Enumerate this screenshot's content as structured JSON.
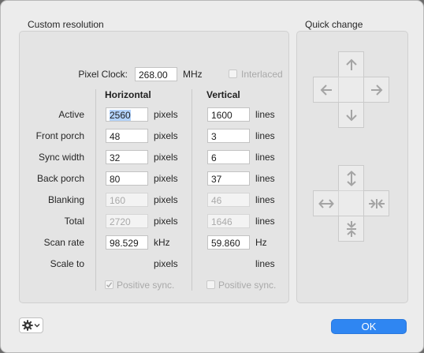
{
  "custom_resolution": {
    "title": "Custom resolution",
    "pixel_clock": {
      "label": "Pixel Clock:",
      "value": "268.00",
      "unit": "MHz"
    },
    "interlaced": {
      "label": "Interlaced",
      "checked": false
    },
    "horizontal_header": "Horizontal",
    "vertical_header": "Vertical",
    "rows": [
      {
        "label": "Active",
        "h_value": "2560",
        "h_unit": "pixels",
        "v_value": "1600",
        "v_unit": "lines"
      },
      {
        "label": "Front porch",
        "h_value": "48",
        "h_unit": "pixels",
        "v_value": "3",
        "v_unit": "lines"
      },
      {
        "label": "Sync width",
        "h_value": "32",
        "h_unit": "pixels",
        "v_value": "6",
        "v_unit": "lines"
      },
      {
        "label": "Back porch",
        "h_value": "80",
        "h_unit": "pixels",
        "v_value": "37",
        "v_unit": "lines"
      },
      {
        "label": "Blanking",
        "h_value": "160",
        "h_unit": "pixels",
        "v_value": "46",
        "v_unit": "lines"
      },
      {
        "label": "Total",
        "h_value": "2720",
        "h_unit": "pixels",
        "v_value": "1646",
        "v_unit": "lines"
      },
      {
        "label": "Scan rate",
        "h_value": "98.529",
        "h_unit": "kHz",
        "v_value": "59.860",
        "v_unit": "Hz"
      },
      {
        "label": "Scale to",
        "h_value": "",
        "h_unit": "pixels",
        "v_value": "",
        "v_unit": "lines"
      }
    ],
    "h_positive_sync": {
      "label": "Positive sync.",
      "checked": true
    },
    "v_positive_sync": {
      "label": "Positive sync.",
      "checked": false
    }
  },
  "quick_change": {
    "title": "Quick change",
    "move_buttons": [
      "arrow-up-icon",
      "arrow-left-icon",
      "arrow-right-icon",
      "arrow-down-icon"
    ],
    "size_buttons": [
      "expand-vertical-icon",
      "expand-horizontal-icon",
      "shrink-horizontal-icon",
      "shrink-vertical-icon"
    ]
  },
  "footer": {
    "gear_icon": "gear-icon",
    "ok_label": "OK"
  },
  "colors": {
    "accent": "#2f86f2",
    "selection": "#b3d3fb"
  }
}
